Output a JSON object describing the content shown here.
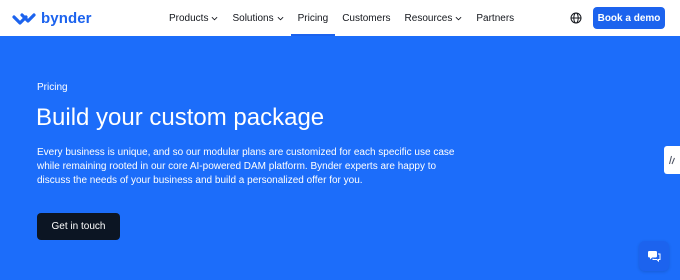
{
  "brand": {
    "name": "bynder",
    "color": "#1c63ee",
    "icon": "bynder-logo-icon"
  },
  "nav": {
    "items": [
      {
        "label": "Products",
        "has_dropdown": true,
        "active": false
      },
      {
        "label": "Solutions",
        "has_dropdown": true,
        "active": false
      },
      {
        "label": "Pricing",
        "has_dropdown": false,
        "active": true
      },
      {
        "label": "Customers",
        "has_dropdown": false,
        "active": false
      },
      {
        "label": "Resources",
        "has_dropdown": true,
        "active": false
      },
      {
        "label": "Partners",
        "has_dropdown": false,
        "active": false
      }
    ],
    "globe_icon": "globe-icon",
    "demo_button": "Book a demo"
  },
  "hero": {
    "background": "#1c6dfa",
    "eyebrow": "Pricing",
    "title": "Build your custom package",
    "description_lines": [
      "Every business is unique, and so our modular plans are customized for each specific use case",
      "while remaining rooted in our core AI-powered DAM platform. Bynder experts are happy to",
      "discuss the needs of your business and build a personalized offer for you."
    ],
    "cta": "Get in touch"
  },
  "widgets": {
    "side_tab_icon": "feedback-icon",
    "chat_icon": "chat-icon"
  }
}
